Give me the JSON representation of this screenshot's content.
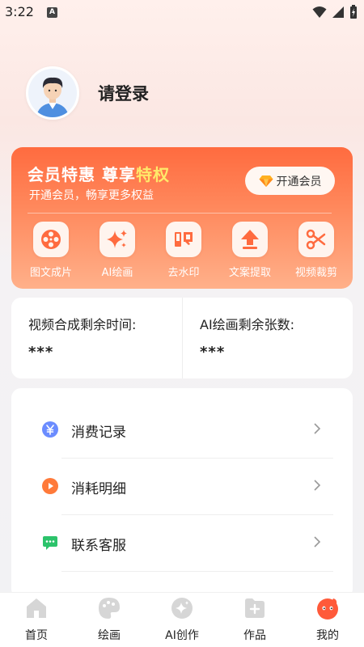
{
  "status_bar": {
    "time": "3:22",
    "notification_badge": "A"
  },
  "profile": {
    "login_text": "请登录"
  },
  "vip": {
    "title_part1": "会员特惠 尊享",
    "title_highlight": "特权",
    "subtitle": "开通会员，畅享更多权益",
    "button_label": "开通会员",
    "features": [
      {
        "label": "图文成片",
        "icon": "film-reel-icon"
      },
      {
        "label": "AI绘画",
        "icon": "sparkle-icon"
      },
      {
        "label": "去水印",
        "icon": "stamp-icon"
      },
      {
        "label": "文案提取",
        "icon": "upload-icon"
      },
      {
        "label": "视频裁剪",
        "icon": "scissors-icon"
      }
    ]
  },
  "stats": {
    "video_label": "视频合成剩余时间:",
    "video_value": "***",
    "ai_label": "AI绘画剩余张数:",
    "ai_value": "***"
  },
  "menu": [
    {
      "label": "消费记录",
      "icon": "yen-icon",
      "color": "#6b8cff"
    },
    {
      "label": "消耗明细",
      "icon": "play-icon",
      "color": "#ff7a3a"
    },
    {
      "label": "联系客服",
      "icon": "chat-icon",
      "color": "#2cc36b"
    }
  ],
  "tabs": [
    {
      "label": "首页",
      "icon": "home-icon"
    },
    {
      "label": "绘画",
      "icon": "palette-icon"
    },
    {
      "label": "AI创作",
      "icon": "ai-create-icon"
    },
    {
      "label": "作品",
      "icon": "works-icon"
    },
    {
      "label": "我的",
      "icon": "profile-icon",
      "active": true
    }
  ],
  "colors": {
    "accent": "#ff6b3f",
    "highlight": "#ffe96a",
    "tab_inactive": "#d6d6d6"
  }
}
